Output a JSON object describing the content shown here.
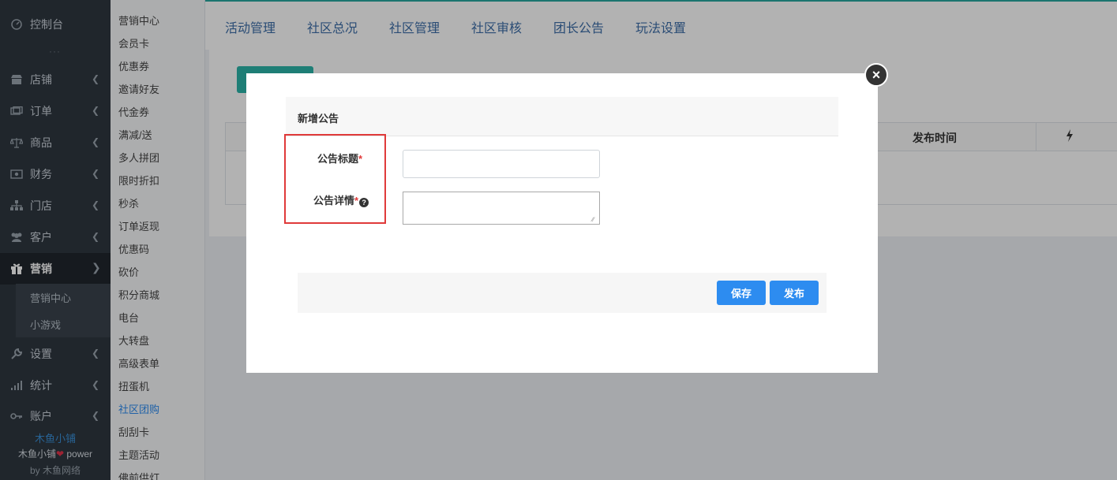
{
  "sidebar": {
    "dashboard": "控制台",
    "dots": "···",
    "items": [
      {
        "label": "店铺",
        "icon": "shop-icon"
      },
      {
        "label": "订单",
        "icon": "order-icon"
      },
      {
        "label": "商品",
        "icon": "scale-icon"
      },
      {
        "label": "财务",
        "icon": "money-icon"
      },
      {
        "label": "门店",
        "icon": "sitemap-icon"
      },
      {
        "label": "客户",
        "icon": "users-icon"
      },
      {
        "label": "营销",
        "icon": "gift-icon"
      },
      {
        "label": "设置",
        "icon": "wrench-icon"
      },
      {
        "label": "统计",
        "icon": "bar-chart-icon"
      },
      {
        "label": "账户",
        "icon": "key-icon"
      }
    ],
    "sub_items": [
      "营销中心",
      "小游戏"
    ],
    "brand": "木鱼小铺",
    "power_prefix": "木鱼小铺",
    "power_suffix": " power",
    "by": "by 木鱼网络"
  },
  "submenu": {
    "items": [
      "营销中心",
      "会员卡",
      "优惠券",
      "邀请好友",
      "代金券",
      "满减/送",
      "多人拼团",
      "限时折扣",
      "秒杀",
      "订单返现",
      "优惠码",
      "砍价",
      "积分商城",
      "电台",
      "大转盘",
      "高级表单",
      "扭蛋机",
      "社区团购",
      "刮刮卡",
      "主题活动",
      "佛前供灯"
    ],
    "current": "社区团购"
  },
  "tabs": [
    "活动管理",
    "社区总况",
    "社区管理",
    "社区审核",
    "团长公告",
    "玩法设置"
  ],
  "table": {
    "publish_time_header": "发布时间",
    "action_icon": "lightning-icon"
  },
  "modal": {
    "panel_title": "新增公告",
    "title_label": "公告标题",
    "detail_label": "公告详情",
    "required_mark": "*",
    "title_value": "",
    "detail_value": "",
    "save_label": "保存",
    "publish_label": "发布",
    "close_glyph": "×"
  },
  "colors": {
    "accent_blue": "#2d8cf0",
    "teal": "#2bb5a9",
    "highlight_red": "#e03a3a",
    "sidebar_bg": "#2f3740"
  }
}
